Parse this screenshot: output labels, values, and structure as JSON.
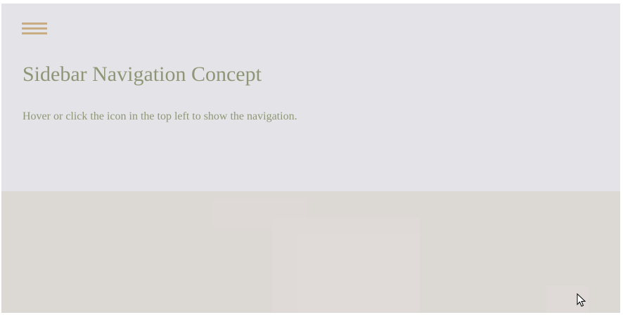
{
  "page": {
    "title": "Sidebar Navigation Concept",
    "description": "Hover or click the icon in the top left to show the navigation."
  },
  "colors": {
    "accent": "#c8ad82",
    "text": "#8f9676",
    "top_background": "#e4e4e8",
    "bottom_background": "#dcd8d4"
  },
  "icons": {
    "menu": "hamburger-icon",
    "cursor": "mouse-pointer-icon"
  }
}
